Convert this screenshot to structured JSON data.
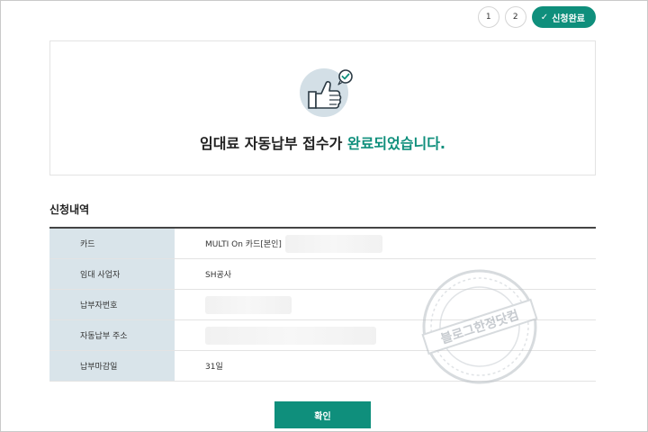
{
  "steps": {
    "items": [
      "1",
      "2"
    ],
    "active_label": "신청완료"
  },
  "done": {
    "message_prefix": "임대료 자동납부 접수가 ",
    "message_accent": "완료되었습니다."
  },
  "section_title": "신청내역",
  "table": {
    "rows": [
      {
        "label": "카드",
        "value": "MULTI On 카드[본인]"
      },
      {
        "label": "임대 사업자",
        "value": "SH공사"
      },
      {
        "label": "납부자번호",
        "value": ""
      },
      {
        "label": "자동납부 주소",
        "value": ""
      },
      {
        "label": "납부마감일",
        "value": "31일"
      }
    ]
  },
  "watermark": {
    "text": "블로그한정닷컴"
  },
  "confirm_label": "확인",
  "colors": {
    "accent": "#0f8f7c",
    "table_header_bg": "#d9e4ea",
    "icon_bg": "#d3dfe6"
  }
}
